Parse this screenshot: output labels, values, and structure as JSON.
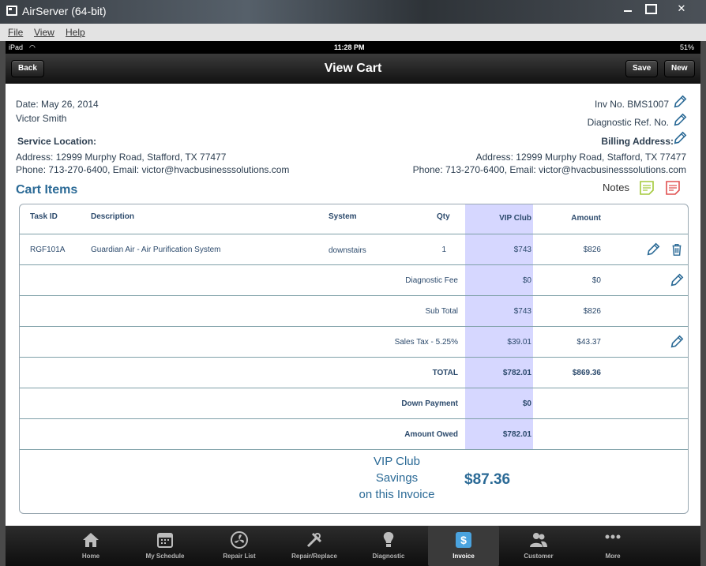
{
  "window": {
    "title": "AirServer (64-bit)",
    "menu": [
      "File",
      "View",
      "Help"
    ]
  },
  "status_bar": {
    "device": "iPad",
    "time": "11:28 PM",
    "battery": "51%"
  },
  "nav": {
    "back_label": "Back",
    "title": "View Cart",
    "save_label": "Save",
    "new_label": "New"
  },
  "customer": {
    "date": "Date: May 26, 2014",
    "name": "Victor Smith",
    "service_location_label": "Service Location:",
    "service_address": "Address: 12999 Murphy Road, Stafford, TX 77477",
    "service_phone": "Phone: 713-270-6400, Email: victor@hvacbusinesssolutions.com"
  },
  "billing": {
    "inv_no": "Inv No. BMS1007",
    "diagnostic_ref": "Diagnostic Ref. No.",
    "billing_address_label": "Billing Address:",
    "address": "Address: 12999 Murphy Road, Stafford, TX 77477",
    "phone": "Phone: 713-270-6400, Email: victor@hvacbusinesssolutions.com"
  },
  "cart": {
    "title": "Cart Items",
    "notes_label": "Notes",
    "columns": {
      "task_id": "Task ID",
      "description": "Description",
      "system": "System",
      "qty": "Qty",
      "vip": "VIP Club",
      "amount": "Amount"
    },
    "item": {
      "task_id": "RGF101A",
      "description": "Guardian Air - Air Purification System",
      "system": "downstairs",
      "qty": "1",
      "vip": "$743",
      "amount": "$826"
    },
    "summary": [
      {
        "label": "Diagnostic Fee",
        "vip": "$0",
        "amount": "$0"
      },
      {
        "label": "Sub Total",
        "vip": "$743",
        "amount": "$826"
      },
      {
        "label": "Sales Tax - 5.25%",
        "vip": "$39.01",
        "amount": "$43.37"
      },
      {
        "label": "TOTAL",
        "vip": "$782.01",
        "amount": "$869.36"
      },
      {
        "label": "Down Payment",
        "vip": "$0",
        "amount": ""
      },
      {
        "label": "Amount Owed",
        "vip": "$782.01",
        "amount": ""
      }
    ],
    "savings_line1": "VIP Club",
    "savings_line2": "Savings",
    "savings_line3": "on this Invoice",
    "savings_amount": "$87.36"
  },
  "tabs": [
    {
      "label": "Home",
      "icon": "home-icon"
    },
    {
      "label": "My Schedule",
      "icon": "calendar-icon"
    },
    {
      "label": "Repair List",
      "icon": "fan-icon"
    },
    {
      "label": "Repair/Replace",
      "icon": "tools-icon"
    },
    {
      "label": "Diagnostic",
      "icon": "lightbulb-icon"
    },
    {
      "label": "Invoice",
      "icon": "dollar-icon",
      "active": true
    },
    {
      "label": "Customer",
      "icon": "people-icon"
    },
    {
      "label": "More",
      "icon": "more-dots-icon"
    }
  ],
  "colors": {
    "accent": "#2b6a96",
    "vip_column": "#d6d7ff",
    "row_line": "#7fa0a8"
  }
}
